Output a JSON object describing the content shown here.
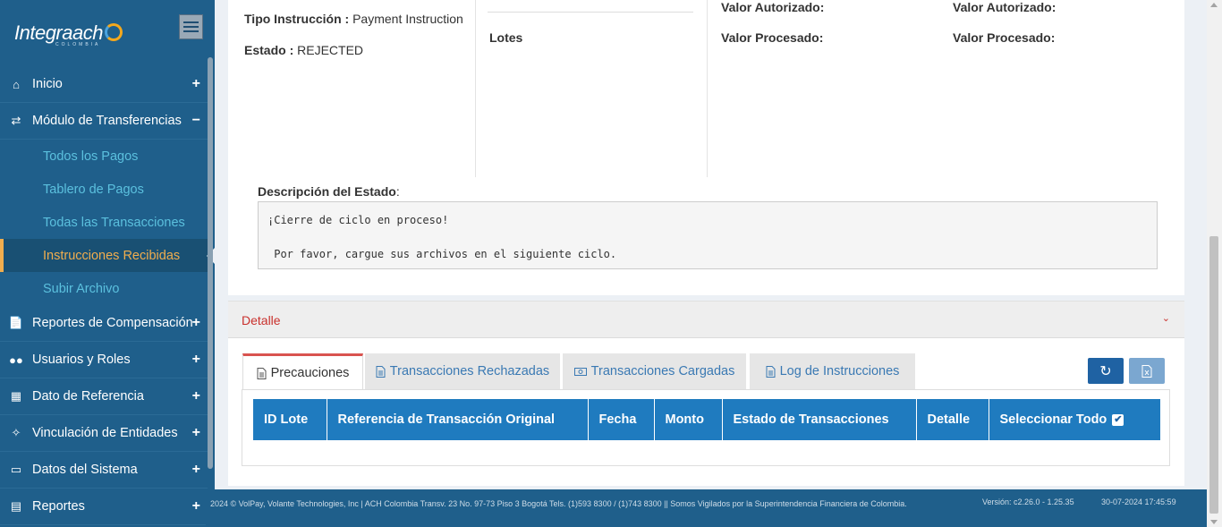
{
  "logo": {
    "text": "Integraach",
    "sub": "COLOMBIA"
  },
  "sidebar": {
    "items": [
      {
        "label": "Inicio",
        "icon": "home-icon",
        "toggle": "+"
      },
      {
        "label": "Módulo de Transferencias",
        "icon": "exchange-icon",
        "toggle": "−"
      },
      {
        "label": "Reportes de Compensación",
        "icon": "file-icon",
        "toggle": "+"
      },
      {
        "label": "Usuarios y Roles",
        "icon": "users-icon",
        "toggle": "+"
      },
      {
        "label": "Dato de Referencia",
        "icon": "calendar-icon",
        "toggle": "+"
      },
      {
        "label": "Vinculación de Entidades",
        "icon": "link-icon",
        "toggle": "+"
      },
      {
        "label": "Datos del Sistema",
        "icon": "monitor-icon",
        "toggle": "+"
      },
      {
        "label": "Reportes",
        "icon": "report-icon",
        "toggle": "+"
      }
    ],
    "subitems": [
      {
        "label": "Todos los Pagos"
      },
      {
        "label": "Tablero de Pagos"
      },
      {
        "label": "Todas las Transacciones"
      },
      {
        "label": "Instrucciones Recibidas"
      },
      {
        "label": "Subir Archivo"
      }
    ]
  },
  "info": {
    "tipo_label": "Tipo Instrucción :",
    "tipo_value": "Payment Instruction",
    "estado_label": "Estado :",
    "estado_value": "REJECTED",
    "lotes_label": "Lotes",
    "valor_aut_1": "Valor Autorizado:",
    "valor_proc_1": "Valor Procesado:",
    "valor_aut_2": "Valor Autorizado:",
    "valor_proc_2": "Valor Procesado:"
  },
  "description": {
    "label": "Descripción del Estado",
    "colon": ":",
    "text": "¡Cierre de ciclo en proceso!\n\n Por favor, cargue sus archivos en el siguiente ciclo."
  },
  "detalle": {
    "title": "Detalle",
    "chevron": "⌄"
  },
  "tabs": [
    {
      "label": "Precauciones"
    },
    {
      "label": "Transacciones Rechazadas"
    },
    {
      "label": "Transacciones Cargadas"
    },
    {
      "label": "Log de Instrucciones"
    }
  ],
  "table": {
    "headers": [
      "ID Lote",
      "Referencia de Transacción Original",
      "Fecha",
      "Monto",
      "Estado de Transacciones",
      "Detalle",
      "Seleccionar Todo"
    ],
    "select_all_checked": "✔"
  },
  "footer": {
    "copyright": "2024 © VolPay, Volante Technologies, Inc | ACH Colombia Transv. 23 No. 97-73 Piso 3 Bogotá Tels. (1)593 8300 / (1)743 8300 || Somos Vigilados por la Superintendencia Financiera de Colombia.",
    "version": "Versión: c2.26.0 - 1.25.35",
    "datetime": "30-07-2024 17:45:59"
  },
  "colors": {
    "sidebar": "#1f5f8b",
    "accent": "#f0ad4e",
    "table_header": "#1f7bbf",
    "danger": "#c9302c"
  }
}
